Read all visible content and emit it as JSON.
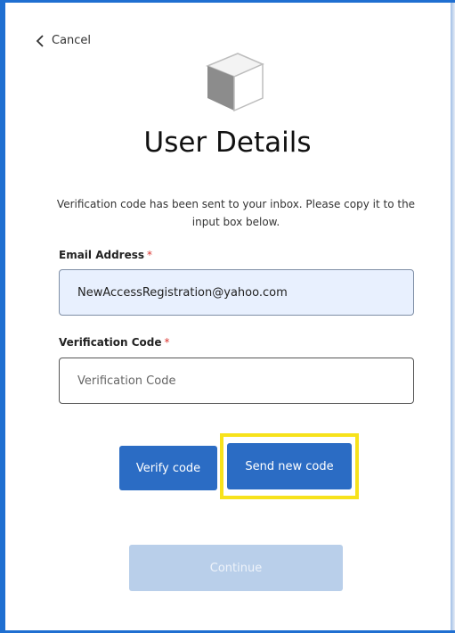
{
  "nav": {
    "cancel_label": "Cancel"
  },
  "header": {
    "title": "User Details"
  },
  "info_text": "Verification code has been sent to your inbox. Please copy it to the input box below.",
  "form": {
    "email_label": "Email Address",
    "email_required": "*",
    "email_value": "NewAccessRegistration@yahoo.com",
    "code_label": "Verification Code",
    "code_required": "*",
    "code_value": "",
    "code_placeholder": "Verification Code"
  },
  "buttons": {
    "verify_label": "Verify code",
    "send_new_label": "Send new code",
    "continue_label": "Continue"
  },
  "colors": {
    "accent": "#2b6cc4",
    "disabled": "#b9cfea",
    "highlight": "#f7e21b",
    "required": "#d9332e",
    "autofill": "#e8f0fe"
  },
  "icons": {
    "back": "chevron-left-icon",
    "logo": "cube-logo"
  }
}
